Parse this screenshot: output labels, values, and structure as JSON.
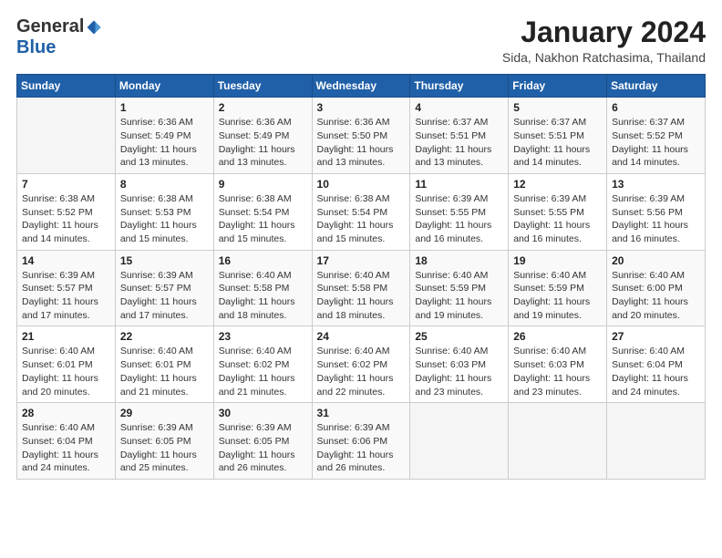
{
  "logo": {
    "general": "General",
    "blue": "Blue"
  },
  "title": "January 2024",
  "subtitle": "Sida, Nakhon Ratchasima, Thailand",
  "weekdays": [
    "Sunday",
    "Monday",
    "Tuesday",
    "Wednesday",
    "Thursday",
    "Friday",
    "Saturday"
  ],
  "weeks": [
    [
      {
        "day": "",
        "info": ""
      },
      {
        "day": "1",
        "info": "Sunrise: 6:36 AM\nSunset: 5:49 PM\nDaylight: 11 hours\nand 13 minutes."
      },
      {
        "day": "2",
        "info": "Sunrise: 6:36 AM\nSunset: 5:49 PM\nDaylight: 11 hours\nand 13 minutes."
      },
      {
        "day": "3",
        "info": "Sunrise: 6:36 AM\nSunset: 5:50 PM\nDaylight: 11 hours\nand 13 minutes."
      },
      {
        "day": "4",
        "info": "Sunrise: 6:37 AM\nSunset: 5:51 PM\nDaylight: 11 hours\nand 13 minutes."
      },
      {
        "day": "5",
        "info": "Sunrise: 6:37 AM\nSunset: 5:51 PM\nDaylight: 11 hours\nand 14 minutes."
      },
      {
        "day": "6",
        "info": "Sunrise: 6:37 AM\nSunset: 5:52 PM\nDaylight: 11 hours\nand 14 minutes."
      }
    ],
    [
      {
        "day": "7",
        "info": "Sunrise: 6:38 AM\nSunset: 5:52 PM\nDaylight: 11 hours\nand 14 minutes."
      },
      {
        "day": "8",
        "info": "Sunrise: 6:38 AM\nSunset: 5:53 PM\nDaylight: 11 hours\nand 15 minutes."
      },
      {
        "day": "9",
        "info": "Sunrise: 6:38 AM\nSunset: 5:54 PM\nDaylight: 11 hours\nand 15 minutes."
      },
      {
        "day": "10",
        "info": "Sunrise: 6:38 AM\nSunset: 5:54 PM\nDaylight: 11 hours\nand 15 minutes."
      },
      {
        "day": "11",
        "info": "Sunrise: 6:39 AM\nSunset: 5:55 PM\nDaylight: 11 hours\nand 16 minutes."
      },
      {
        "day": "12",
        "info": "Sunrise: 6:39 AM\nSunset: 5:55 PM\nDaylight: 11 hours\nand 16 minutes."
      },
      {
        "day": "13",
        "info": "Sunrise: 6:39 AM\nSunset: 5:56 PM\nDaylight: 11 hours\nand 16 minutes."
      }
    ],
    [
      {
        "day": "14",
        "info": "Sunrise: 6:39 AM\nSunset: 5:57 PM\nDaylight: 11 hours\nand 17 minutes."
      },
      {
        "day": "15",
        "info": "Sunrise: 6:39 AM\nSunset: 5:57 PM\nDaylight: 11 hours\nand 17 minutes."
      },
      {
        "day": "16",
        "info": "Sunrise: 6:40 AM\nSunset: 5:58 PM\nDaylight: 11 hours\nand 18 minutes."
      },
      {
        "day": "17",
        "info": "Sunrise: 6:40 AM\nSunset: 5:58 PM\nDaylight: 11 hours\nand 18 minutes."
      },
      {
        "day": "18",
        "info": "Sunrise: 6:40 AM\nSunset: 5:59 PM\nDaylight: 11 hours\nand 19 minutes."
      },
      {
        "day": "19",
        "info": "Sunrise: 6:40 AM\nSunset: 5:59 PM\nDaylight: 11 hours\nand 19 minutes."
      },
      {
        "day": "20",
        "info": "Sunrise: 6:40 AM\nSunset: 6:00 PM\nDaylight: 11 hours\nand 20 minutes."
      }
    ],
    [
      {
        "day": "21",
        "info": "Sunrise: 6:40 AM\nSunset: 6:01 PM\nDaylight: 11 hours\nand 20 minutes."
      },
      {
        "day": "22",
        "info": "Sunrise: 6:40 AM\nSunset: 6:01 PM\nDaylight: 11 hours\nand 21 minutes."
      },
      {
        "day": "23",
        "info": "Sunrise: 6:40 AM\nSunset: 6:02 PM\nDaylight: 11 hours\nand 21 minutes."
      },
      {
        "day": "24",
        "info": "Sunrise: 6:40 AM\nSunset: 6:02 PM\nDaylight: 11 hours\nand 22 minutes."
      },
      {
        "day": "25",
        "info": "Sunrise: 6:40 AM\nSunset: 6:03 PM\nDaylight: 11 hours\nand 23 minutes."
      },
      {
        "day": "26",
        "info": "Sunrise: 6:40 AM\nSunset: 6:03 PM\nDaylight: 11 hours\nand 23 minutes."
      },
      {
        "day": "27",
        "info": "Sunrise: 6:40 AM\nSunset: 6:04 PM\nDaylight: 11 hours\nand 24 minutes."
      }
    ],
    [
      {
        "day": "28",
        "info": "Sunrise: 6:40 AM\nSunset: 6:04 PM\nDaylight: 11 hours\nand 24 minutes."
      },
      {
        "day": "29",
        "info": "Sunrise: 6:39 AM\nSunset: 6:05 PM\nDaylight: 11 hours\nand 25 minutes."
      },
      {
        "day": "30",
        "info": "Sunrise: 6:39 AM\nSunset: 6:05 PM\nDaylight: 11 hours\nand 26 minutes."
      },
      {
        "day": "31",
        "info": "Sunrise: 6:39 AM\nSunset: 6:06 PM\nDaylight: 11 hours\nand 26 minutes."
      },
      {
        "day": "",
        "info": ""
      },
      {
        "day": "",
        "info": ""
      },
      {
        "day": "",
        "info": ""
      }
    ]
  ]
}
